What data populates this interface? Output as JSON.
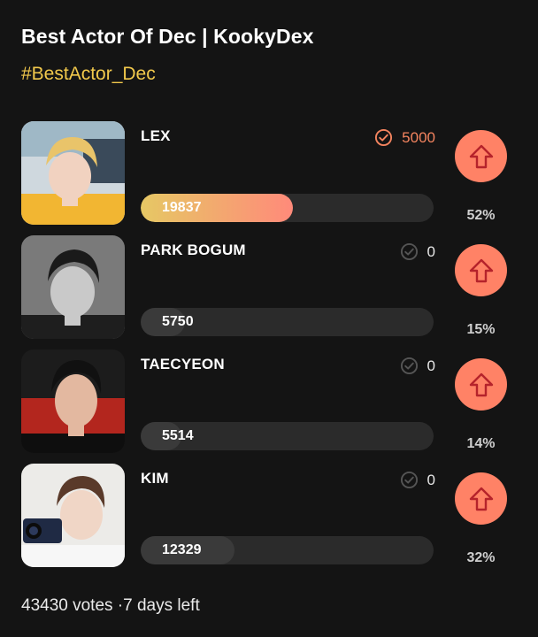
{
  "header": {
    "title": "Best Actor Of Dec | KookyDex",
    "hashtag": "#BestActor_Dec"
  },
  "candidates": [
    {
      "name": "LEX",
      "score": "5000",
      "score_active": true,
      "votes": "19837",
      "percent": "52%",
      "fill": 0.52,
      "photo": "photo-lex"
    },
    {
      "name": "PARK BOGUM",
      "score": "0",
      "score_active": false,
      "votes": "5750",
      "percent": "15%",
      "fill": 0.15,
      "photo": "photo-park-bogum"
    },
    {
      "name": "TAECYEON",
      "score": "0",
      "score_active": false,
      "votes": "5514",
      "percent": "14%",
      "fill": 0.14,
      "photo": "photo-taecyeon"
    },
    {
      "name": "KIM",
      "score": "0",
      "score_active": false,
      "votes": "12329",
      "percent": "32%",
      "fill": 0.32,
      "photo": "photo-kim"
    }
  ],
  "footer": {
    "summary": "43430 votes ·7 days left"
  },
  "colors": {
    "accent": "#ff8266",
    "hashtag": "#f2c94c",
    "background": "#141414"
  },
  "icons": {
    "check": "check-circle-icon",
    "vote": "arrow-up-icon"
  }
}
